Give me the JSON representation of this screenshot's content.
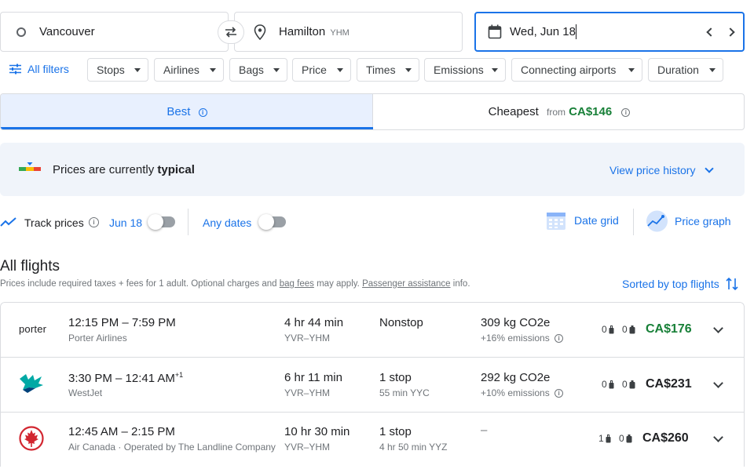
{
  "search": {
    "origin": "Vancouver",
    "destination": "Hamilton",
    "destination_code": "YHM",
    "date": "Wed, Jun 18"
  },
  "filters": {
    "all_filters": "All filters",
    "chips": [
      "Stops",
      "Airlines",
      "Bags",
      "Price",
      "Times",
      "Emissions",
      "Connecting airports",
      "Duration"
    ]
  },
  "sort_tabs": {
    "best": "Best",
    "cheapest": "Cheapest",
    "cheapest_from": "from",
    "cheapest_price": "CA$146"
  },
  "insights": {
    "prices_prefix": "Prices are currently",
    "prices_level": "typical",
    "view_history": "View price history"
  },
  "tracking": {
    "track_prices": "Track prices",
    "track_date": "Jun 18",
    "any_dates": "Any dates",
    "date_grid": "Date grid",
    "price_graph": "Price graph"
  },
  "results": {
    "heading": "All flights",
    "note_prefix": "Prices include required taxes + fees for 1 adult. Optional charges and",
    "bag_fees": "bag fees",
    "note_mid": "may apply.",
    "passenger_assistance": "Passenger assistance",
    "note_suffix": "info.",
    "sorted_by": "Sorted by top flights"
  },
  "flights": [
    {
      "airline_logo_text": "porter",
      "times": "12:15 PM – 7:59 PM",
      "day_offset": "",
      "airline": "Porter Airlines",
      "duration": "4 hr 44 min",
      "route": "YVR–YHM",
      "stops": "Nonstop",
      "stop_detail": "",
      "emissions": "309 kg CO2e",
      "emissions_delta": "+16% emissions",
      "carry_on": "0",
      "checked": "0",
      "price": "CA$176",
      "price_color": "#188038"
    },
    {
      "airline_logo_text": "",
      "times": "3:30 PM – 12:41 AM",
      "day_offset": "+1",
      "airline": "WestJet",
      "duration": "6 hr 11 min",
      "route": "YVR–YHM",
      "stops": "1 stop",
      "stop_detail": "55 min YYC",
      "emissions": "292 kg CO2e",
      "emissions_delta": "+10% emissions",
      "carry_on": "0",
      "checked": "0",
      "price": "CA$231",
      "price_color": "#202124"
    },
    {
      "airline_logo_text": "",
      "times": "12:45 AM – 2:15 PM",
      "day_offset": "",
      "airline": "Air Canada · Operated by The Landline Company I...",
      "duration": "10 hr 30 min",
      "route": "YVR–YHM",
      "stops": "1 stop",
      "stop_detail": "4 hr 50 min YYZ",
      "emissions": "–",
      "emissions_delta": "",
      "carry_on": "1",
      "checked": "0",
      "price": "CA$260",
      "price_color": "#202124"
    }
  ],
  "colors": {
    "accent": "#1a73e8",
    "green_price": "#188038",
    "insight_bg": "#f0f4fa"
  }
}
